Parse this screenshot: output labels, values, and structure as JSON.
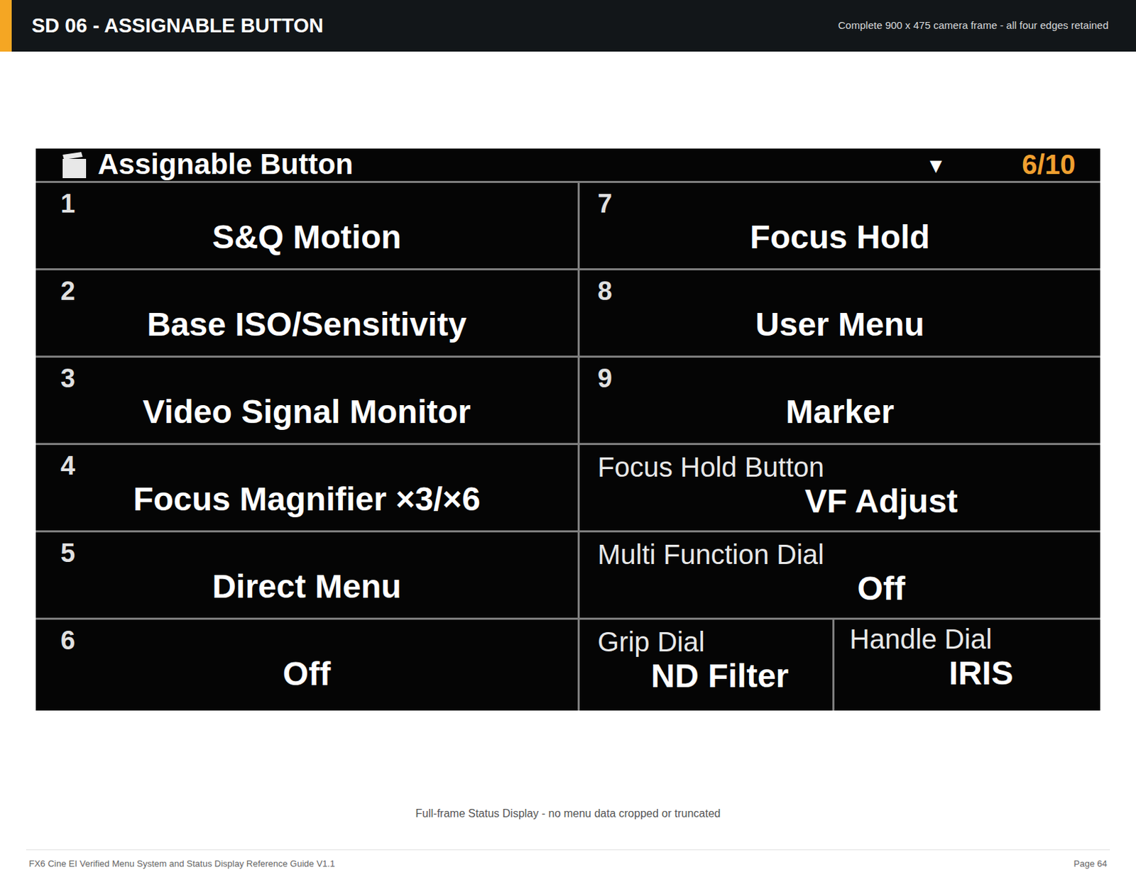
{
  "header": {
    "title": "SD 06 - ASSIGNABLE BUTTON",
    "note": "Complete 900 x 475 camera frame - all four edges retained"
  },
  "camera": {
    "title": "Assignable Button",
    "arrow": "▼",
    "page": "6/10",
    "left": [
      {
        "number": "1",
        "value": "S&Q Motion"
      },
      {
        "number": "2",
        "value": "Base ISO/Sensitivity"
      },
      {
        "number": "3",
        "value": "Video Signal Monitor"
      },
      {
        "number": "4",
        "value": "Focus Magnifier ×3/×6"
      },
      {
        "number": "5",
        "value": "Direct Menu"
      },
      {
        "number": "6",
        "value": "Off"
      }
    ],
    "right": [
      {
        "kind": "number",
        "label": "7",
        "value": "Focus Hold"
      },
      {
        "kind": "number",
        "label": "8",
        "value": "User Menu"
      },
      {
        "kind": "number",
        "label": "9",
        "value": "Marker"
      },
      {
        "kind": "label",
        "label": "Focus Hold Button",
        "value": "VF Adjust"
      },
      {
        "kind": "label",
        "label": "Multi Function Dial",
        "value": "Off"
      }
    ],
    "dials": [
      {
        "label": "Grip Dial",
        "value": "ND Filter"
      },
      {
        "label": "Handle Dial",
        "value": "IRIS"
      }
    ]
  },
  "caption": "Full-frame Status Display - no menu data cropped or truncated",
  "footer": {
    "left": "FX6 Cine EI Verified Menu System and Status Display Reference Guide V1.1",
    "right": "Page 64"
  }
}
